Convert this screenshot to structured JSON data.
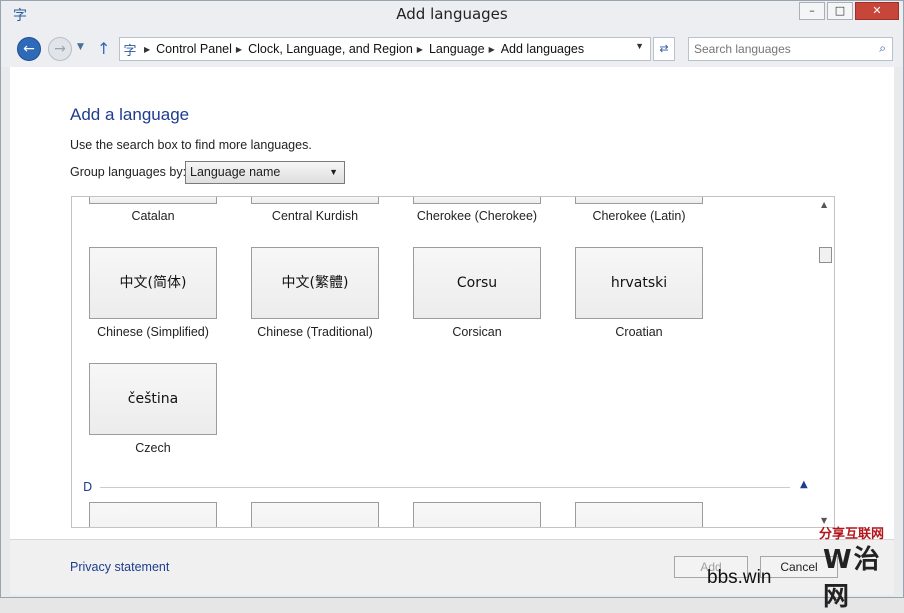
{
  "window": {
    "title": "Add languages",
    "controls": {
      "minimize": "–",
      "maximize": "□",
      "close": "✕"
    }
  },
  "nav": {
    "back_icon": "back-arrow-icon",
    "forward_icon": "forward-arrow-icon",
    "up_icon": "up-arrow-icon",
    "breadcrumbs": [
      "Control Panel",
      "Clock, Language, and Region",
      "Language",
      "Add languages"
    ],
    "search_placeholder": "Search languages"
  },
  "main": {
    "heading": "Add a language",
    "hint": "Use the search box to find more languages.",
    "group_by_label": "Group languages by:",
    "group_by_value": "Language name"
  },
  "languages": {
    "partial_row_labels": [
      "Catalan",
      "Central Kurdish",
      "Cherokee (Cherokee)",
      "Cherokee (Latin)"
    ],
    "tiles": [
      {
        "native": "中文(简体)",
        "label": "Chinese (Simplified)"
      },
      {
        "native": "中文(繁體)",
        "label": "Chinese (Traditional)"
      },
      {
        "native": "Corsu",
        "label": "Corsican"
      },
      {
        "native": "hrvatski",
        "label": "Croatian"
      },
      {
        "native": "čeština",
        "label": "Czech"
      }
    ],
    "section_d": "D"
  },
  "footer": {
    "privacy": "Privacy statement",
    "add_label": "Add",
    "cancel_label": "Cancel"
  },
  "watermark": {
    "text": "bbs.win",
    "site": "分享互联网",
    "big": "W治网"
  }
}
